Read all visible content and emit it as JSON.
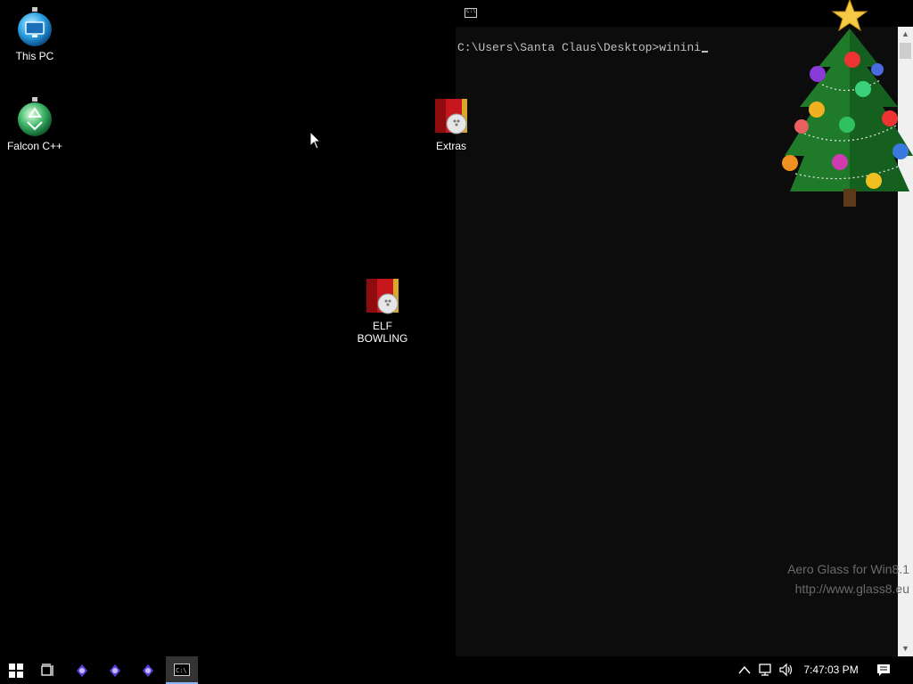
{
  "desktop": {
    "icons": [
      {
        "label": "This PC",
        "icon": "this-pc-ornament-icon"
      },
      {
        "label": "Falcon C++",
        "icon": "recycle-ornament-icon"
      },
      {
        "label": "Extras",
        "icon": "elf-bowling-icon"
      },
      {
        "label": "ELF BOWLING",
        "icon": "elf-bowling-icon"
      }
    ],
    "background_color": "#000000"
  },
  "console": {
    "icon": "cmd-icon",
    "prompt_text": "C:\\Users\\Santa Claus\\Desktop>winini",
    "text_color": "#c0c0c0",
    "background_color": "#0c0c0c"
  },
  "watermark": {
    "line1": "Aero Glass for Win8.1",
    "line2": "http://www.glass8.eu"
  },
  "decoration": {
    "icon": "christmas-tree-icon"
  },
  "taskbar": {
    "buttons": [
      {
        "icon": "start-windows-icon"
      },
      {
        "icon": "task-view-icon"
      },
      {
        "icon": "app-icon-1"
      },
      {
        "icon": "app-icon-2"
      },
      {
        "icon": "app-icon-3"
      },
      {
        "icon": "cmd-icon",
        "active": true
      }
    ],
    "tray": {
      "icons": [
        "chevron-up-icon",
        "network-icon",
        "volume-icon",
        "notification-icon"
      ],
      "time": "7:47:03 PM"
    }
  }
}
